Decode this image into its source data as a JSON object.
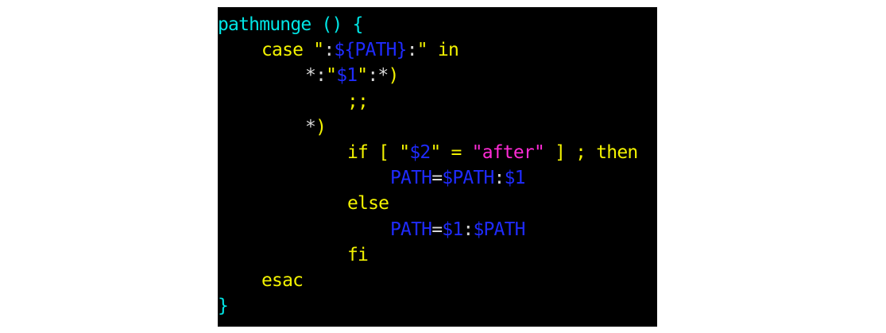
{
  "terminal": {
    "background": "#000000",
    "colors": {
      "cyan": "#00e5e5",
      "yellow": "#f2f200",
      "blue": "#1f2bff",
      "magenta": "#ff2bd6",
      "white": "#d8d8d8"
    },
    "lines": [
      {
        "tokens": [
          "pathmunge () {"
        ]
      },
      {
        "tokens": [
          "case ",
          "\"",
          ":",
          "${PATH}",
          ":",
          "\"",
          " in"
        ]
      },
      {
        "tokens": [
          "*",
          ":",
          "\"",
          "$1",
          "\"",
          ":",
          "*",
          ")"
        ]
      },
      {
        "tokens": [
          ";;"
        ]
      },
      {
        "tokens": [
          "*",
          ")"
        ]
      },
      {
        "tokens": [
          "if [ ",
          "\"",
          "$2",
          "\"",
          " = ",
          "\"",
          "after",
          "\"",
          " ] ; then"
        ]
      },
      {
        "tokens": [
          "PATH",
          "=",
          "$PATH",
          ":",
          "$1"
        ]
      },
      {
        "tokens": [
          "else"
        ]
      },
      {
        "tokens": [
          "PATH",
          "=",
          "$1",
          ":",
          "$PATH"
        ]
      },
      {
        "tokens": [
          "fi"
        ]
      },
      {
        "tokens": [
          "esac"
        ]
      },
      {
        "tokens": [
          "}"
        ]
      }
    ]
  }
}
